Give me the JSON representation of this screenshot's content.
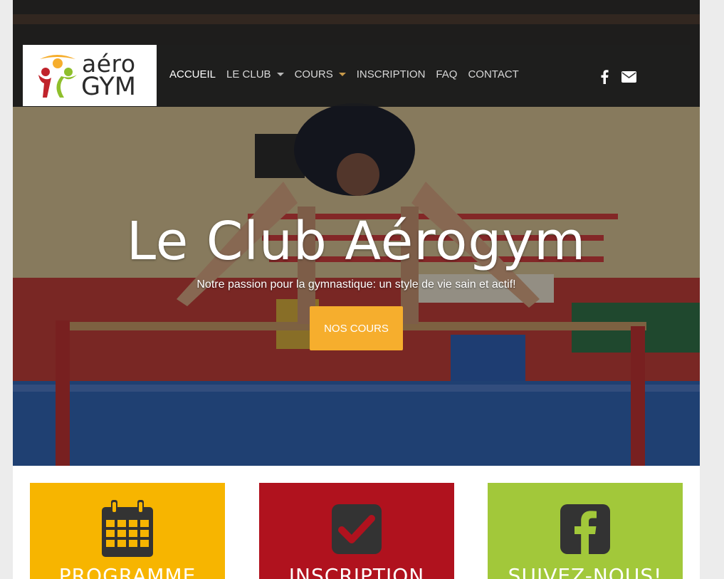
{
  "colors": {
    "accent_orange": "#f6ae2d",
    "card_yellow": "#f7b500",
    "card_red": "#b0121e",
    "card_green": "#a2c83a",
    "icon_dark": "#333333"
  },
  "logo": {
    "line1": "aéro",
    "line2": "GYM"
  },
  "nav": {
    "items": [
      {
        "label": "ACCUEIL",
        "active": true
      },
      {
        "label": "LE CLUB",
        "dropdown": true
      },
      {
        "label": "COURS",
        "dropdown": true
      },
      {
        "label": "INSCRIPTION"
      },
      {
        "label": "FAQ"
      },
      {
        "label": "CONTACT"
      }
    ],
    "social": [
      "facebook-icon",
      "envelope-icon"
    ]
  },
  "hero": {
    "title": "Le Club Aérogym",
    "subtitle": "Notre passion pour la gymnastique: un style de vie sain et actif!",
    "cta_label": "NOS COURS"
  },
  "cards": [
    {
      "label": "PROGRAMME",
      "icon": "calendar-icon",
      "color": "#f7b500"
    },
    {
      "label": "INSCRIPTION",
      "icon": "checkbox-icon",
      "color": "#b0121e"
    },
    {
      "label": "SUIVEZ-NOUS!",
      "icon": "facebook-icon",
      "color": "#a2c83a"
    }
  ]
}
